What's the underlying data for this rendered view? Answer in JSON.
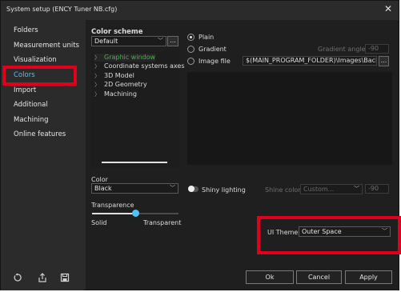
{
  "window": {
    "title": "System setup (ENCY Tuner NB.cfg)",
    "close_glyph": "✕"
  },
  "sidebar": {
    "items": [
      {
        "label": "Folders"
      },
      {
        "label": "Measurement units"
      },
      {
        "label": "Visualization"
      },
      {
        "label": "Colors",
        "active": true
      },
      {
        "label": "Import"
      },
      {
        "label": "Additional"
      },
      {
        "label": "Machining"
      },
      {
        "label": "Online features"
      }
    ]
  },
  "color_scheme": {
    "heading": "Color scheme",
    "selected": "Default",
    "more_label": "...",
    "tree": [
      {
        "label": "Graphic window",
        "selected": true
      },
      {
        "label": "Coordinate systems axes"
      },
      {
        "label": "3D Model"
      },
      {
        "label": "2D Geometry"
      },
      {
        "label": "Machining"
      }
    ]
  },
  "background": {
    "options": [
      {
        "label": "Plain",
        "checked": true
      },
      {
        "label": "Gradient",
        "checked": false
      },
      {
        "label": "Image file",
        "checked": false
      }
    ],
    "gradient_angle_label": "Gradient angle",
    "gradient_angle_value": "-90",
    "image_path": "$(MAIN_PROGRAM_FOLDER)\\Images\\Back",
    "image_more_label": "..."
  },
  "color": {
    "label": "Color",
    "selected": "Black"
  },
  "shiny": {
    "label": "Shiny lighting",
    "enabled": false
  },
  "shine_color": {
    "label": "Shine color",
    "selected": "Custom...",
    "value": "-90"
  },
  "transparence": {
    "label": "Transparence",
    "min_label": "Solid",
    "max_label": "Transparent",
    "value": 0.5
  },
  "ui_theme": {
    "label": "UI Theme",
    "selected": "Outer Space"
  },
  "footer": {
    "ok_label": "Ok",
    "cancel_label": "Cancel",
    "apply_label": "Apply",
    "icons": [
      "reset-icon",
      "export-icon",
      "save-icon"
    ]
  },
  "colors": {
    "active_nav": "#4fc3f7",
    "selected_tree": "#4caf50",
    "highlight": "#e0001b"
  }
}
